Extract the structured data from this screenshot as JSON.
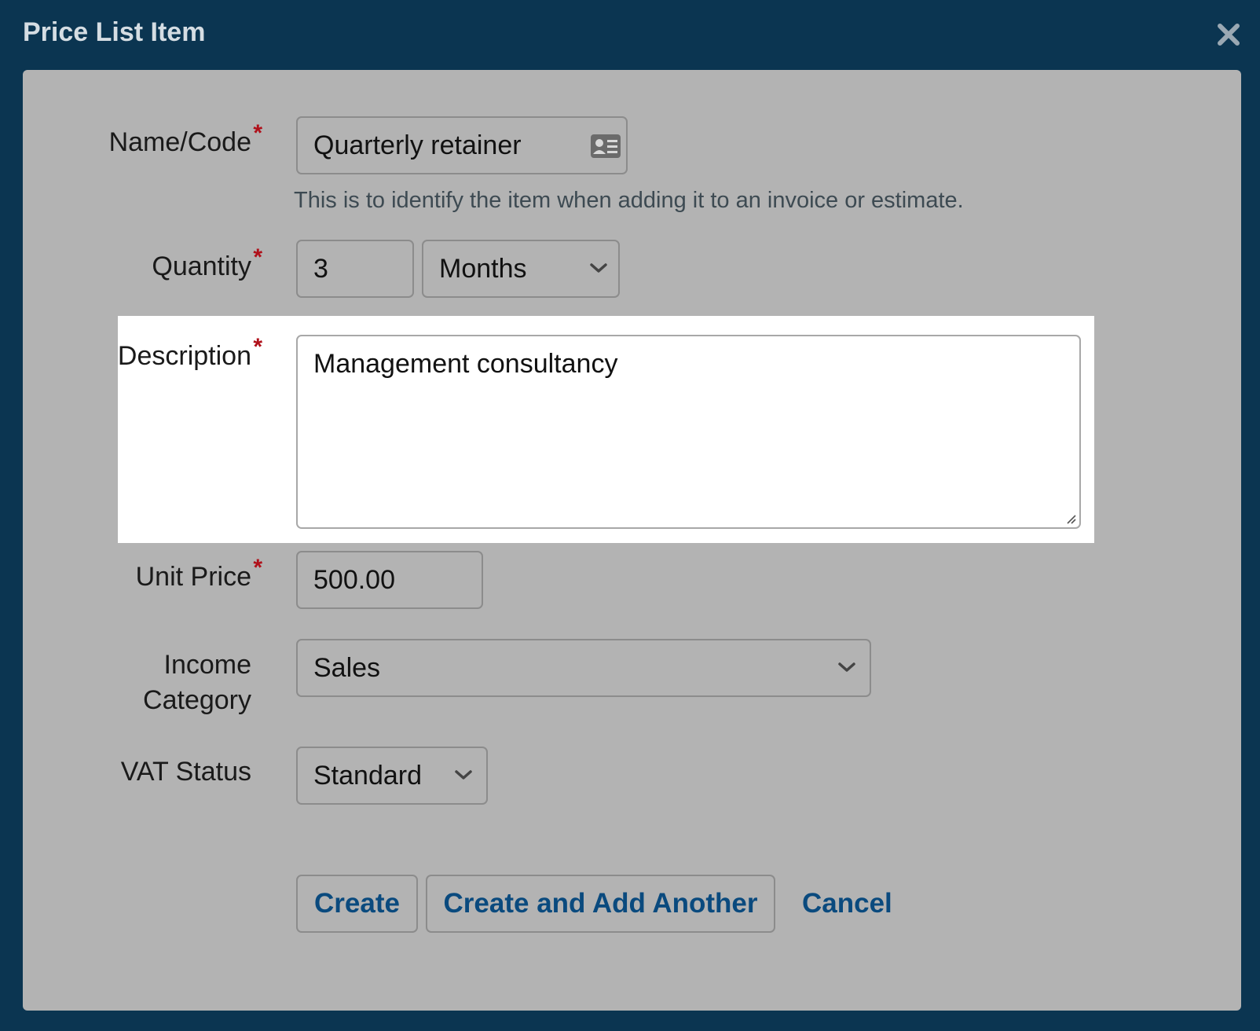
{
  "dialog": {
    "title": "Price List Item",
    "close_icon": "close-icon"
  },
  "form": {
    "name_code": {
      "label": "Name/Code",
      "value": "Quarterly retainer",
      "icon": "contact-card-icon",
      "hint": "This is to identify the item when adding it to an invoice or estimate."
    },
    "quantity": {
      "label": "Quantity",
      "value": "3",
      "unit": "Months"
    },
    "description": {
      "label": "Description",
      "value": "Management consultancy"
    },
    "unit_price": {
      "label": "Unit Price",
      "value": "500.00"
    },
    "income_category": {
      "label_line1": "Income",
      "label_line2": "Category",
      "value": "Sales"
    },
    "vat_status": {
      "label": "VAT Status",
      "value": "Standard"
    }
  },
  "actions": {
    "create": "Create",
    "create_another": "Create and Add Another",
    "cancel": "Cancel"
  },
  "colors": {
    "backdrop": "#0b3551",
    "panel": "#b3b3b3",
    "required": "#b0101a",
    "link": "#0a4a7e",
    "highlight": "#ffffff"
  }
}
